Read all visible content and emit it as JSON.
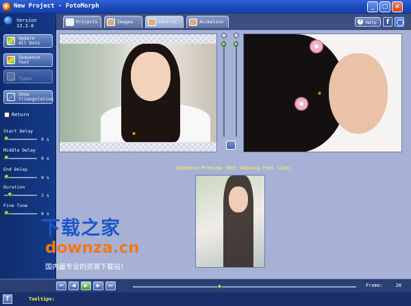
{
  "window": {
    "title": "New Project - FotoMorph"
  },
  "sidebar": {
    "version": "Version 13.2.6",
    "buttons": [
      {
        "label": "Update\nAll Dots",
        "icon": "dots-icon"
      },
      {
        "label": "Sequence\nText",
        "icon": "sequence-text-icon"
      },
      {
        "label": "\nTypes",
        "icon": "types-icon",
        "disabled": true
      },
      {
        "label": "Show\nTriangulation",
        "icon": "triangulation-icon"
      }
    ],
    "return_label": "Return",
    "sliders": [
      {
        "label": "Start Delay",
        "value": "0 s",
        "level": 0
      },
      {
        "label": "Middle Delay",
        "value": "0 s",
        "level": 0
      },
      {
        "label": "End Delay",
        "value": "0 s",
        "level": 0
      },
      {
        "label": "Duration",
        "value": "2 s",
        "level": 0.1
      },
      {
        "label": "Fine Tune",
        "value": "0 s",
        "level": 0
      }
    ]
  },
  "tabs": [
    {
      "label": "Projects",
      "active": false
    },
    {
      "label": "Images",
      "active": false
    },
    {
      "label": "Control",
      "active": true
    },
    {
      "label": "Animation",
      "active": false
    }
  ],
  "help": {
    "label": "Help"
  },
  "preview": {
    "title": "Sequence Preview (Not showing real size)"
  },
  "watermark": {
    "line1": "下载之家",
    "line2": "downza.cn",
    "line3": "国内最专业的资源下载站！"
  },
  "timeline": {
    "frame_label": "Frame:",
    "frame_value": "20",
    "position": 0.39
  },
  "tooltips": {
    "label": "Tooltips:"
  },
  "colors": {
    "accent_yellow": "#ffff40",
    "brand_blue": "#1a58c8",
    "brand_orange": "#f07818"
  }
}
